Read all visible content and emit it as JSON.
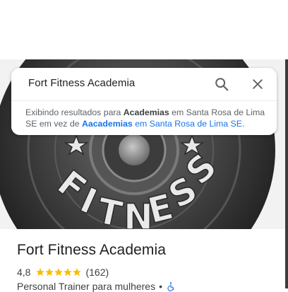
{
  "search": {
    "query": "Fort Fitness Academia",
    "notice_prefix": "Exibindo resultados para",
    "corrected_term": "Academias",
    "notice_middle": "em Santa Rosa de Lima SE em vez de",
    "original_term": "Aacademias",
    "original_suffix": "em Santa Rosa de Lima SE",
    "notice_end": "."
  },
  "hero": {
    "plate_text": "FITNESS"
  },
  "place": {
    "name": "Fort Fitness Academia",
    "rating": "4,8",
    "review_count": "(162)",
    "stars_filled": 5,
    "category": "Personal Trainer para mulheres",
    "separator": "•"
  },
  "colors": {
    "star": "#fbbc04",
    "link": "#1a73e8",
    "plate": "#2b2b2b"
  }
}
